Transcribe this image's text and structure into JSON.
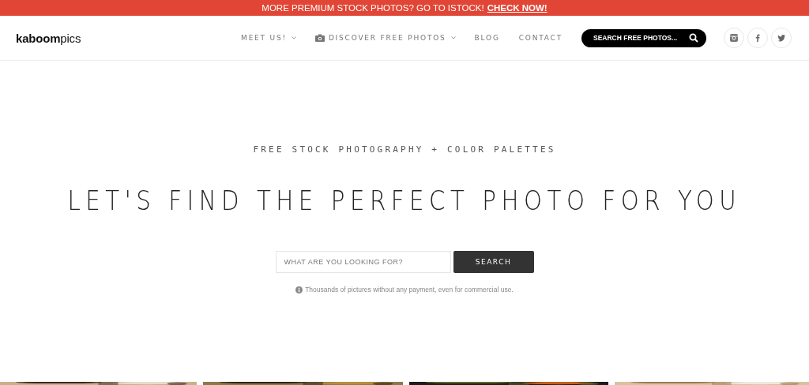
{
  "banner": {
    "text": "MORE PREMIUM STOCK PHOTOS? GO TO ISTOCK!",
    "link": "CHECK NOW!"
  },
  "logo": "**kaboom**pics",
  "nav": [
    {
      "label": "MEET US!",
      "kind": "text",
      "dropdown": true
    },
    {
      "label": "DISCOVER FREE PHOTOS",
      "kind": "camera",
      "dropdown": true
    },
    {
      "label": "BLOG",
      "kind": "text",
      "dropdown": false
    },
    {
      "label": "CONTACT",
      "kind": "text",
      "dropdown": false
    }
  ],
  "nav_search": {
    "placeholder": "SEARCH FREE PHOTOS..."
  },
  "social": [
    {
      "kind": "instagram"
    },
    {
      "kind": "facebook"
    },
    {
      "kind": "twitter"
    }
  ],
  "hero": {
    "subtitle": "FREE STOCK PHOTOGRAPHY + COLOR PALETTES",
    "title": "LET'S FIND THE PERFECT PHOTO FOR YOU",
    "search": {
      "placeholder": "WHAT ARE YOU LOOKING FOR?",
      "button": "SEARCH"
    },
    "note": "Thousands of pictures without any payment, even for commercial use."
  }
}
